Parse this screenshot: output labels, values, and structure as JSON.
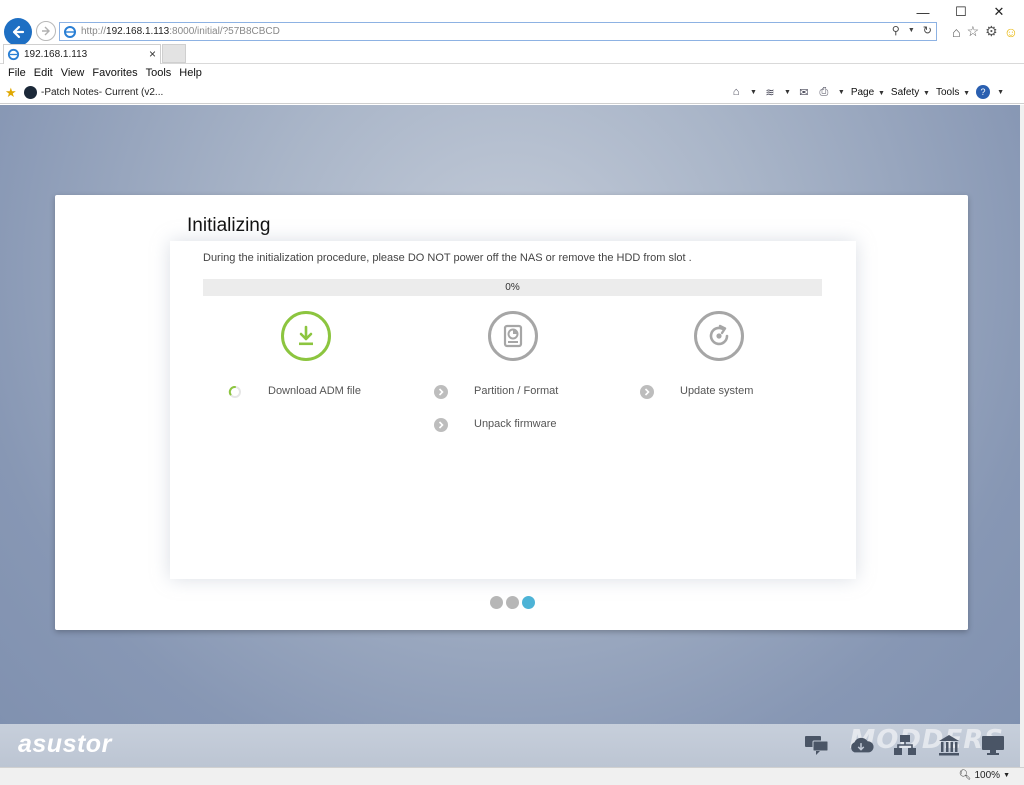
{
  "browser": {
    "url_prefix": "http://",
    "url_host": "192.168.1.113",
    "url_rest": ":8000/initial/?57B8CBCD",
    "tab_title": "192.168.1.113",
    "menu": [
      "File",
      "Edit",
      "View",
      "Favorites",
      "Tools",
      "Help"
    ],
    "favorite_link": "-Patch Notes- Current (v2...",
    "commands": [
      "Page",
      "Safety",
      "Tools"
    ],
    "zoom": "100%"
  },
  "page": {
    "title": "Initializing",
    "notice": "During the initialization procedure, please DO NOT power off the NAS or remove the HDD from slot .",
    "progress_percent": 0,
    "progress_text": "0%",
    "steps": [
      {
        "label": "Download ADM file",
        "state": "in-progress",
        "icon": "download-icon"
      },
      {
        "label": "Partition / Format",
        "state": "pending",
        "icon": "hdd-icon"
      },
      {
        "label": "Unpack firmware",
        "state": "pending"
      },
      {
        "label": "Update system",
        "state": "pending",
        "icon": "refresh-icon"
      }
    ],
    "pager": {
      "total": 3,
      "active": 3
    }
  },
  "footer": {
    "brand": "asustor",
    "watermark": "MODDERS",
    "icons": [
      "chat-icon",
      "cloud-download-icon",
      "network-icon",
      "institution-icon",
      "monitor-icon"
    ]
  },
  "colors": {
    "accent_green": "#8cc53f",
    "pager_active": "#4db3d6",
    "ie_blue": "#1e6fc3"
  }
}
